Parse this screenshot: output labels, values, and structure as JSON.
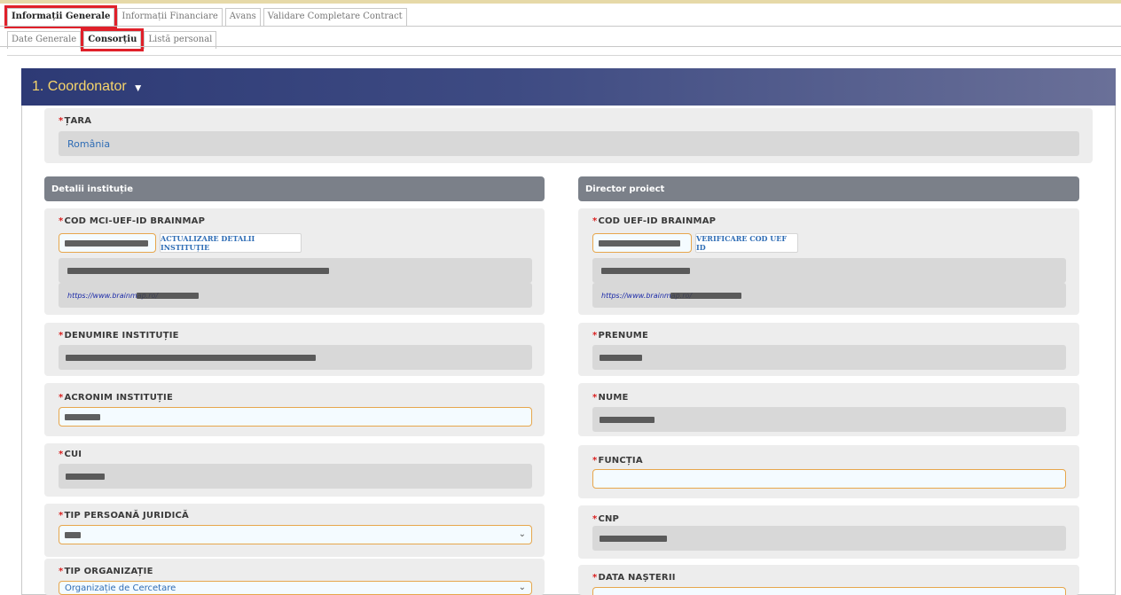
{
  "tabs_main": [
    {
      "label": "Informații Generale",
      "active": true
    },
    {
      "label": "Informații Financiare",
      "active": false
    },
    {
      "label": "Avans",
      "active": false
    },
    {
      "label": "Validare Completare Contract",
      "active": false
    }
  ],
  "tabs_sub": [
    {
      "label": "Date Generale",
      "active": false
    },
    {
      "label": "Consorțiu",
      "active": true
    },
    {
      "label": "Listă personal",
      "active": false
    }
  ],
  "panel": {
    "title": "1. Coordonator",
    "caret": "▼"
  },
  "country": {
    "label": "ȚARA",
    "value": "România"
  },
  "left": {
    "header": "Detalii instituție",
    "cod": {
      "label": "COD MCI-UEF-ID BRAINMAP",
      "button": "ACTUALIZARE DETALII INSTITUȚIE",
      "link": "https://www.brainmap.ro/"
    },
    "denumire": {
      "label": "DENUMIRE INSTITUȚIE"
    },
    "acronim": {
      "label": "ACRONIM INSTITUȚIE"
    },
    "cui": {
      "label": "CUI"
    },
    "tip_persoana": {
      "label": "TIP PERSOANĂ JURIDICĂ"
    },
    "tip_org": {
      "label": "TIP ORGANIZAȚIE",
      "value": "Organizație de Cercetare"
    }
  },
  "right": {
    "header": "Director proiect",
    "cod": {
      "label": "COD UEF-ID BRAINMAP",
      "button": "VERIFICARE COD UEF ID",
      "link": "https://www.brainmap.ro/"
    },
    "prenume": {
      "label": "PRENUME"
    },
    "nume": {
      "label": "NUME"
    },
    "functia": {
      "label": "FUNCȚIA"
    },
    "cnp": {
      "label": "CNP"
    },
    "data_nasterii": {
      "label": "DATA NAȘTERII"
    }
  },
  "required_mark": "*",
  "select_arrow": "⌄",
  "colors": {
    "accent_title": "#f7d56b",
    "required": "#d92020",
    "highlight": "#e0202a",
    "input_border": "#e7a64c"
  }
}
